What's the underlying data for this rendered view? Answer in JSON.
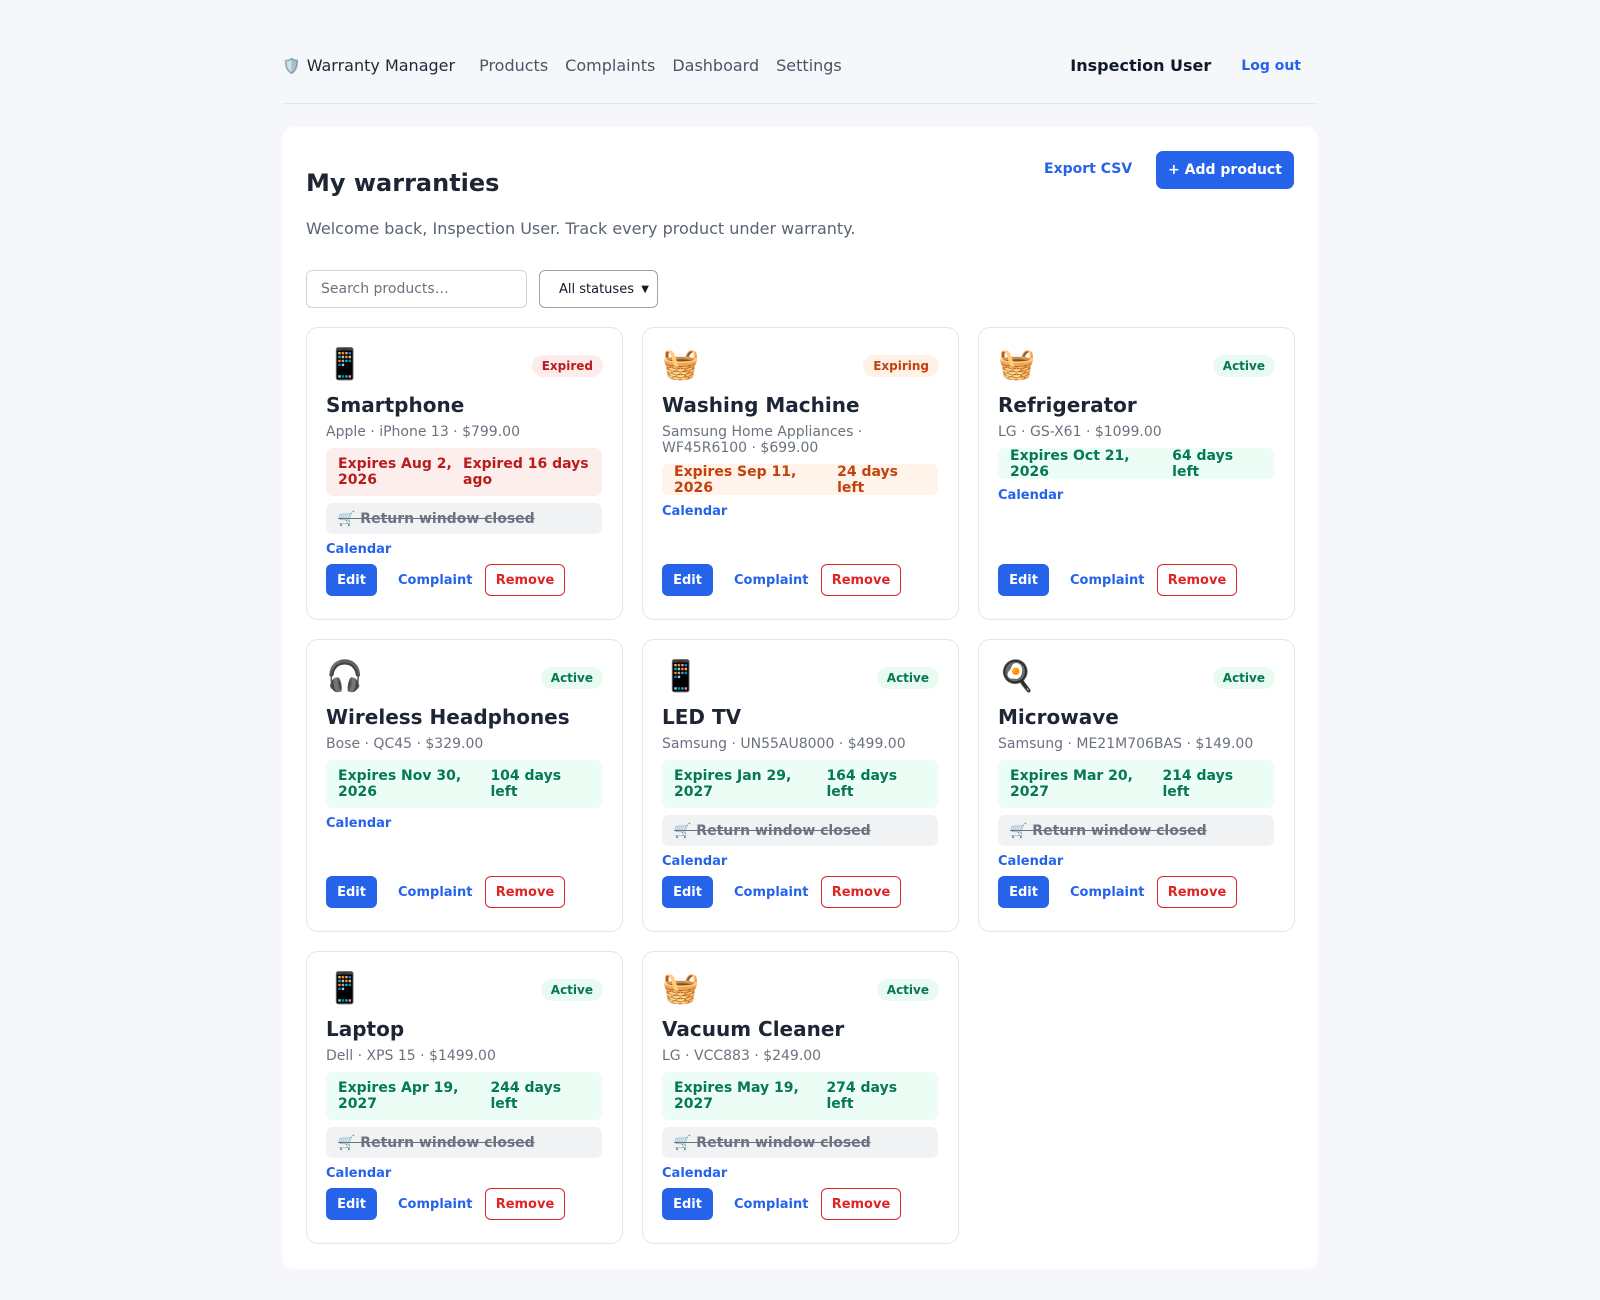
{
  "nav": {
    "brand_icon": "🛡️",
    "brand": "Warranty Manager",
    "links": [
      "Products",
      "Complaints",
      "Dashboard",
      "Settings"
    ],
    "user": "Inspection User",
    "logout": "Log out"
  },
  "page": {
    "title": "My warranties",
    "welcome": "Welcome back, Inspection User. Track every product under warranty.",
    "export_label": "Export CSV",
    "add_label": "+ Add product",
    "search_placeholder": "Search products…",
    "status_filter": "All statuses"
  },
  "labels": {
    "calendar": "Calendar",
    "edit": "Edit",
    "complaint": "Complaint",
    "remove": "Remove"
  },
  "colors": {
    "accent": "#2563eb",
    "danger": "#dc2626",
    "expired": "#b91c1c",
    "expiring": "#c2410c",
    "active": "#047857"
  },
  "products": [
    {
      "icon": "📱",
      "status": "Expired",
      "name": "Smartphone",
      "meta": "Apple · iPhone 13 · $799.00",
      "expires": "Expires Aug 2, 2026",
      "remaining": "Expired 16 days ago",
      "return_note": "🛒 Return window closed"
    },
    {
      "icon": "🧺",
      "status": "Expiring",
      "name": "Washing Machine",
      "meta": "Samsung Home Appliances · WF45R6100 · $699.00",
      "expires": "Expires Sep 11, 2026",
      "remaining": "24 days left",
      "return_note": ""
    },
    {
      "icon": "🧺",
      "status": "Active",
      "name": "Refrigerator",
      "meta": "LG · GS-X61 · $1099.00",
      "expires": "Expires Oct 21, 2026",
      "remaining": "64 days left",
      "return_note": ""
    },
    {
      "icon": "🎧",
      "status": "Active",
      "name": "Wireless Headphones",
      "meta": "Bose · QC45 · $329.00",
      "expires": "Expires Nov 30, 2026",
      "remaining": "104 days left",
      "return_note": ""
    },
    {
      "icon": "📱",
      "status": "Active",
      "name": "LED TV",
      "meta": "Samsung · UN55AU8000 · $499.00",
      "expires": "Expires Jan 29, 2027",
      "remaining": "164 days left",
      "return_note": "🛒 Return window closed"
    },
    {
      "icon": "🍳",
      "status": "Active",
      "name": "Microwave",
      "meta": "Samsung · ME21M706BAS · $149.00",
      "expires": "Expires Mar 20, 2027",
      "remaining": "214 days left",
      "return_note": "🛒 Return window closed"
    },
    {
      "icon": "📱",
      "status": "Active",
      "name": "Laptop",
      "meta": "Dell · XPS 15 · $1499.00",
      "expires": "Expires Apr 19, 2027",
      "remaining": "244 days left",
      "return_note": "🛒 Return window closed"
    },
    {
      "icon": "🧺",
      "status": "Active",
      "name": "Vacuum Cleaner",
      "meta": "LG · VCC883 · $249.00",
      "expires": "Expires May 19, 2027",
      "remaining": "274 days left",
      "return_note": "🛒 Return window closed"
    }
  ]
}
